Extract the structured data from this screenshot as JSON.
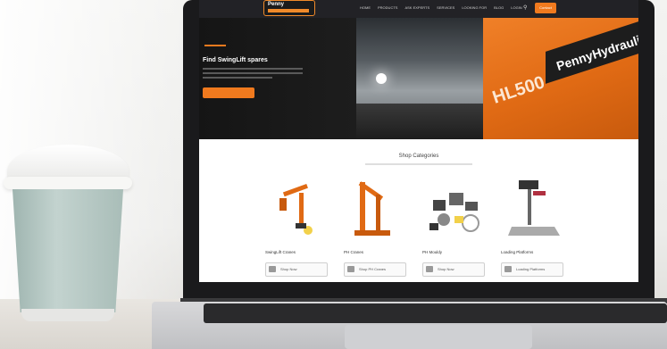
{
  "scene": {
    "objects": [
      "coffee-cup",
      "laptop"
    ]
  },
  "website": {
    "logo": {
      "line1": "Penny",
      "line2": "Hydraulics"
    },
    "nav": {
      "links": [
        "Home",
        "Products",
        "Ask Experts",
        "Services",
        "Looking for",
        "Blog",
        "Login"
      ],
      "cta": "Contact"
    },
    "hero": {
      "title": "Find SwingLift spares",
      "button": "Shop Spares Now",
      "truck_brand": "PennyHydraulic",
      "truck_model": "HL500"
    },
    "categories": {
      "title": "Shop Categories",
      "items": [
        {
          "label": "SwingLift Cranes",
          "button": "Shop Now"
        },
        {
          "label": "PH Cranes",
          "button": "Shop PH Cranes"
        },
        {
          "label": "PH Mouldy",
          "button": "Shop Now"
        },
        {
          "label": "Loading Platforms",
          "button": "Loading Platforms"
        }
      ]
    }
  },
  "colors": {
    "brand_orange": "#f07a1e",
    "nav_dark": "#222226",
    "cup_sleeve": "#a9bdb8"
  }
}
